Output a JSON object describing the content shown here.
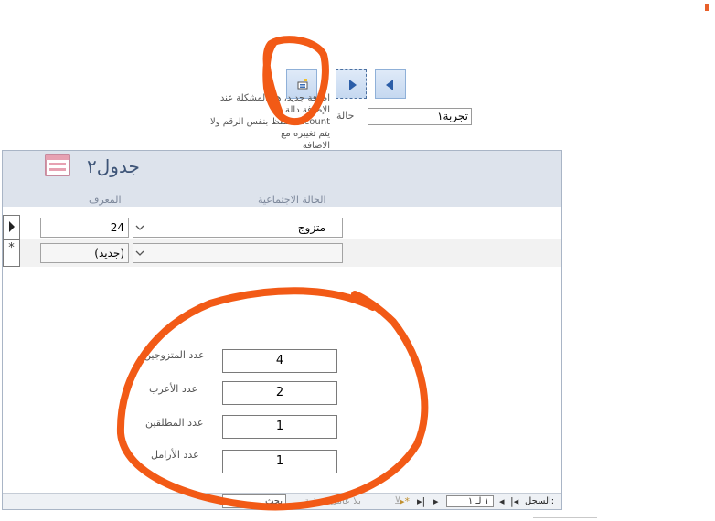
{
  "note": {
    "line1": "اضافة جديد، هنا المشكلة عند الإضافة دالة",
    "line2": "dcount تحتفظ بنفس الرقم ولا يتم تغييره مع",
    "line3": "الاضافة"
  },
  "status": {
    "label": "حالة",
    "value": "تجربة١"
  },
  "form": {
    "title": "جدول٢",
    "col_status": "الحالة الاجتماعية",
    "col_id": "المعرف",
    "rows": [
      {
        "status": "متزوج",
        "id": "24"
      },
      {
        "status": "",
        "id": "(جديد)"
      }
    ],
    "new_row_marker": "*"
  },
  "counts": [
    {
      "label": "عدد المتزوجين",
      "value": "4"
    },
    {
      "label": "عدد الأعزب",
      "value": "2"
    },
    {
      "label": "عدد المطلقين",
      "value": "1"
    },
    {
      "label": "عدد الأرامل",
      "value": "1"
    }
  ],
  "record_nav": {
    "label": "السجل:",
    "position": "١ لـ ١",
    "filter": "بلا عامل تصفية",
    "search": "بحث"
  },
  "icons": [
    "previous-record-icon",
    "next-record-icon",
    "new-record-icon",
    "form-icon",
    "dropdown-arrow-icon",
    "filter-icon"
  ],
  "colors": {
    "annotation": "#f25a16",
    "header": "#dde3ec",
    "title": "#3d5477"
  }
}
